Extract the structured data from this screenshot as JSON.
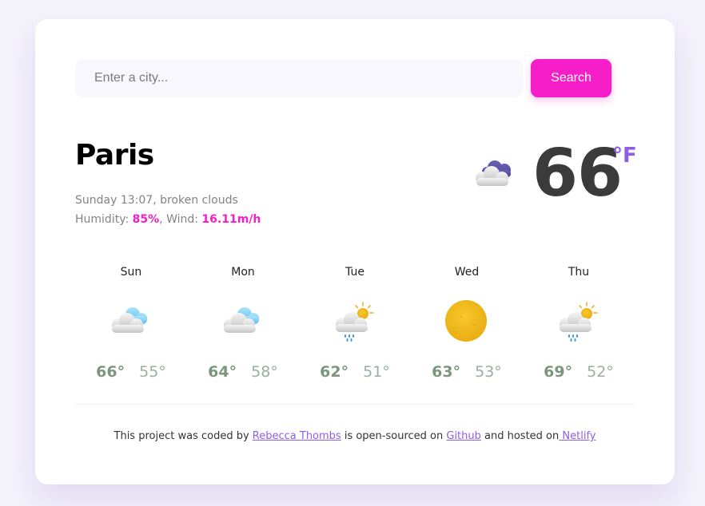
{
  "search": {
    "placeholder": "Enter a city...",
    "button_label": "Search"
  },
  "current": {
    "city": "Paris",
    "day_time": "Sunday 13:07",
    "description": "broken clouds",
    "humidity_label": "Humidity:",
    "humidity": "85%",
    "wind_label": "Wind:",
    "wind": "16.11m/h",
    "temperature": "66",
    "unit": "°F",
    "icon": "cloudy-dark-icon"
  },
  "forecast": [
    {
      "day": "Sun",
      "max": "66°",
      "min": "55°",
      "icon": "cloudy-icon"
    },
    {
      "day": "Mon",
      "max": "64°",
      "min": "58°",
      "icon": "cloudy-icon"
    },
    {
      "day": "Tue",
      "max": "62°",
      "min": "51°",
      "icon": "sun-rain-icon"
    },
    {
      "day": "Wed",
      "max": "63°",
      "min": "53°",
      "icon": "sun-icon"
    },
    {
      "day": "Thu",
      "max": "69°",
      "min": "52°",
      "icon": "sun-rain-icon"
    }
  ],
  "footer": {
    "text_1": "This project was coded by ",
    "author": "Rebecca Thombs",
    "text_2": " is open-sourced on ",
    "github": "Github",
    "text_3": " and hosted on",
    "netlify": " Netlify"
  },
  "colors": {
    "accent_pink": "#f51ec9",
    "accent_purple": "#8f5ee8",
    "background": "#f4f2fb"
  }
}
